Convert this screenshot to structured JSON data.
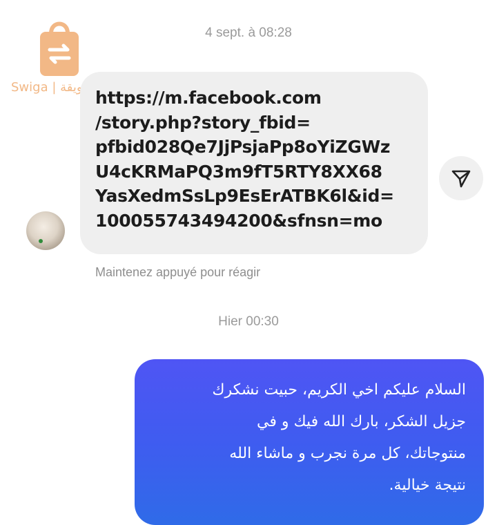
{
  "watermark": {
    "brand_text": "Swiga | سويقة",
    "icon": "shopping-bag-swap-icon",
    "color": "#f2b886"
  },
  "conversation": {
    "timestamps": {
      "first": "4 sept. à 08:28",
      "second": "Hier 00:30"
    },
    "incoming_message": {
      "sender_avatar": "avatar-photo",
      "link_lines": [
        "https://m.facebook.com",
        "/story.php?story_fbid=",
        "pfbid028Qe7JjPsjaPp8oYiZGWz",
        "U4cKRMaPQ3m9fT5RTY8XX68",
        "YasXedmSsLp9EsErATBK6l&id=",
        "100055743494200&sfnsn=mo"
      ],
      "share_icon": "send-arrow-icon",
      "react_hint": "Maintenez appuyé pour réagir"
    },
    "outgoing_message": {
      "lines": [
        "السلام عليكم اخي الكريم، حبيت نشكرك",
        "جزيل الشكر، بارك الله فيك و في",
        "منتوجاتك، كل مرة نجرب و ماشاء الله",
        "نتيجة خيالية."
      ],
      "bubble_gradient": [
        "#4f55f4",
        "#2f6be8"
      ]
    }
  }
}
